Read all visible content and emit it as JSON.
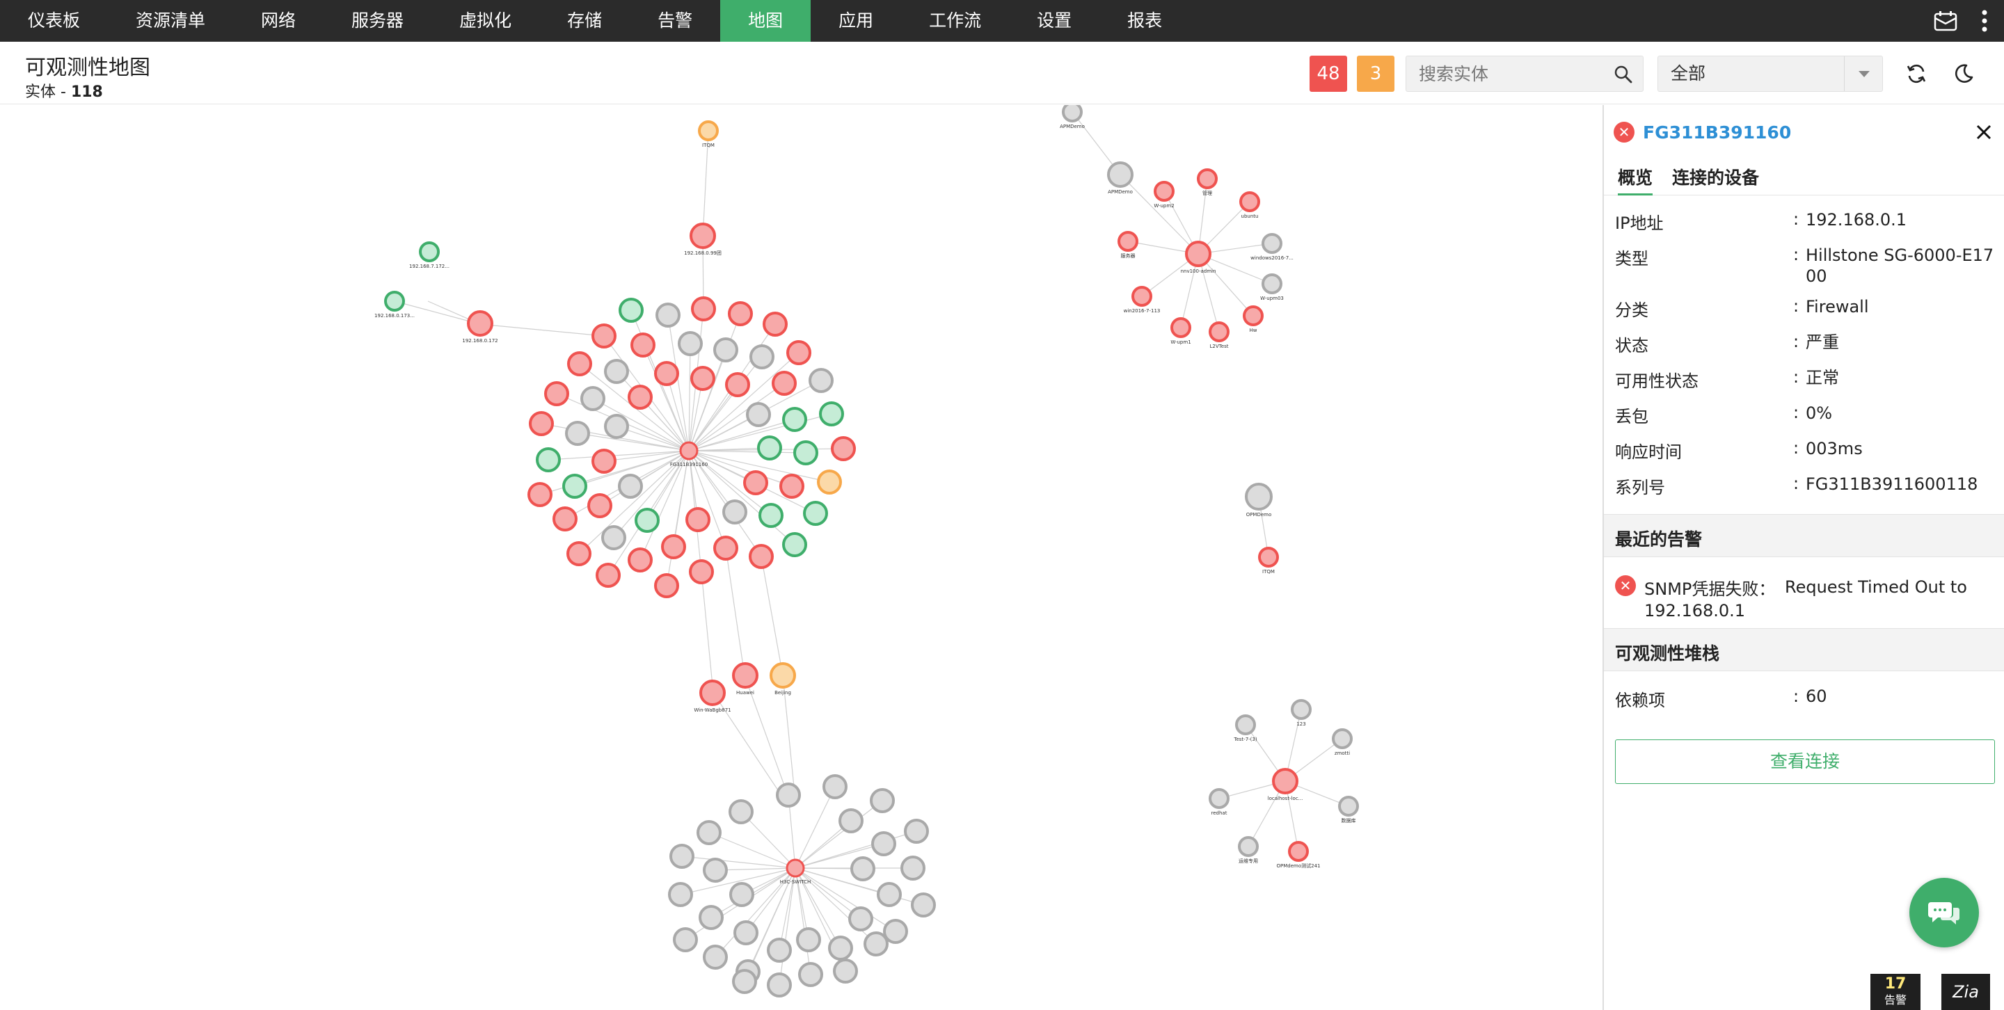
{
  "nav": {
    "items": [
      "仪表板",
      "资源清单",
      "网络",
      "服务器",
      "虚拟化",
      "存储",
      "告警",
      "地图",
      "应用",
      "工作流",
      "设置",
      "报表"
    ],
    "active_index": 7,
    "icons": [
      "calendar-mail-icon",
      "more-vertical-icon"
    ]
  },
  "header": {
    "title": "可观测性地图",
    "entity_label": "实体 - ",
    "entity_count": "118",
    "badge_critical": "48",
    "badge_warning": "3",
    "search_placeholder": "搜索实体",
    "filter_value": "全部",
    "icons": [
      "search-icon",
      "refresh-icon",
      "dark-mode-icon",
      "chevron-down-icon"
    ]
  },
  "colors": {
    "nav_bg": "#2b2b2b",
    "accent_green": "#3fae6b",
    "critical_red": "#ef5350",
    "warning_orange": "#f7a84a",
    "link_blue": "#2d8fd5",
    "node_gray": "#c9c9c9"
  },
  "panel": {
    "device_name": "FG311B391160",
    "tabs": [
      "概览",
      "连接的设备"
    ],
    "properties": [
      {
        "key": "IP地址",
        "value": "192.168.0.1"
      },
      {
        "key": "类型",
        "value": "Hillstone SG-6000-E1700"
      },
      {
        "key": "分类",
        "value": "Firewall"
      },
      {
        "key": "状态",
        "value": "严重"
      },
      {
        "key": "可用性状态",
        "value": "正常"
      },
      {
        "key": "丢包",
        "value": "0%"
      },
      {
        "key": "响应时间",
        "value": "003ms"
      },
      {
        "key": "系列号",
        "value": "FG311B3911600118"
      }
    ],
    "colon": ":",
    "recent_alarms_title": "最近的告警",
    "alarm_label": "SNMP凭据失败：",
    "alarm_message": "Request Timed Out to 192.168.0.1",
    "stack_title": "可观测性堆栈",
    "dependencies_key": "依赖项",
    "dependencies_value": "60",
    "view_button": "查看连接"
  },
  "footer": {
    "alarm_count": "17",
    "alarm_label": "告警",
    "zoho_logo": "Zia"
  },
  "map": {
    "labels": {
      "fg_hub": "FG311B391160",
      "h3c_hub": "H3C-SWITCH",
      "nms_hub": "nnv100-admin",
      "local_hub": "localhost-loc...",
      "itqm_top": "ITQM",
      "node_172": "192.168.0.172",
      "node_173a": "192.168.7.172...",
      "node_173b": "192.168.0.173...",
      "node_cn": "192.168.0.99团",
      "huawei": "Huawei",
      "beijing": "Beijing",
      "win_node": "Win-WaBgb871",
      "apm_top": "APMDemo",
      "apm2": "APMDemo",
      "opm_right": "OPMDemo",
      "itqm_right": "ITQM",
      "test": "Test-7-(3)",
      "n123": "123",
      "zimo": "zmotti",
      "redhat": "redhat",
      "xipian": "数据库",
      "fuwu": "运维专用",
      "opm_demo": "OPMdemo测试241",
      "w1": "W-upm2",
      "w2": "管理",
      "w3": "ubuntu",
      "w4": "windows2016-7...",
      "w5": "W-upm03",
      "w6": "Hw",
      "w7": "L2VTest",
      "w8": "W-upm1",
      "w9": "win2016-7-113",
      "w10": "服务器"
    }
  }
}
